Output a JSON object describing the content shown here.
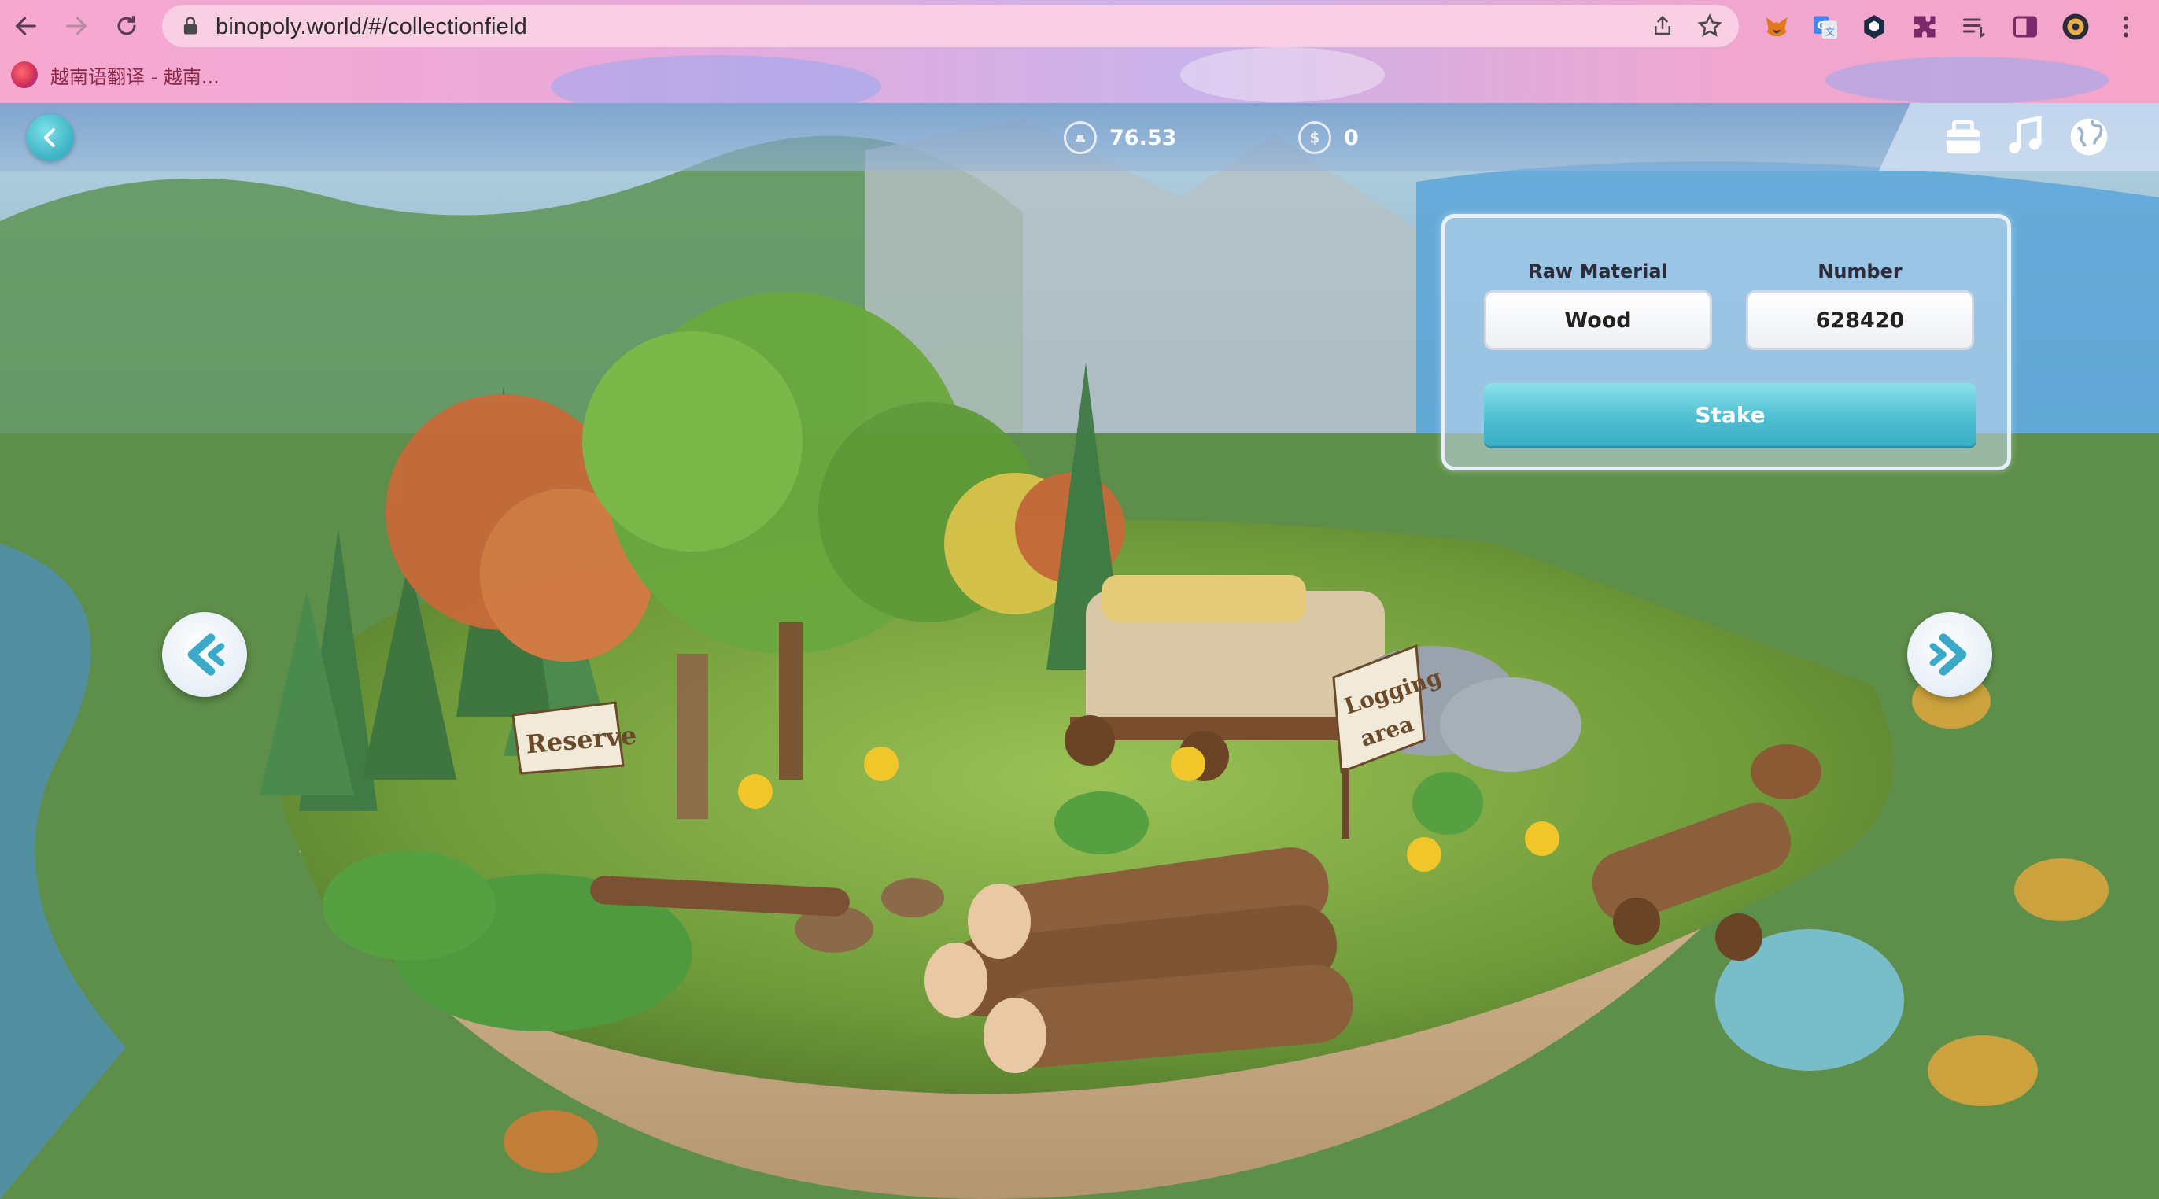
{
  "browser": {
    "url": "binopoly.world/#/collectionfield",
    "bookmark_label": "越南语翻译 - 越南...",
    "icons": [
      "back-arrow-icon",
      "forward-arrow-icon",
      "reload-icon",
      "lock-icon",
      "share-icon",
      "star-icon",
      "metamask-fox-icon",
      "google-translate-icon",
      "extension-hex-icon",
      "puzzle-icon",
      "reading-list-icon",
      "side-panel-icon",
      "profile-avatar",
      "kebab-menu-icon"
    ]
  },
  "game": {
    "balances": [
      {
        "icon": "token-coin-icon",
        "value": "76.53"
      },
      {
        "icon": "dollar-coin-icon",
        "value": "0"
      }
    ],
    "top_icons": [
      "backpack-icon",
      "music-note-icon",
      "globe-icon"
    ],
    "scene_signs": {
      "reserve": "Reserve",
      "logging": "Logging area"
    },
    "panel": {
      "raw_material_label": "Raw Material",
      "number_label": "Number",
      "raw_material_value": "Wood",
      "number_value": "628420",
      "stake_label": "Stake"
    },
    "colors": {
      "accent": "#4fbfd2",
      "panel_border": "#ebf2fc"
    }
  }
}
